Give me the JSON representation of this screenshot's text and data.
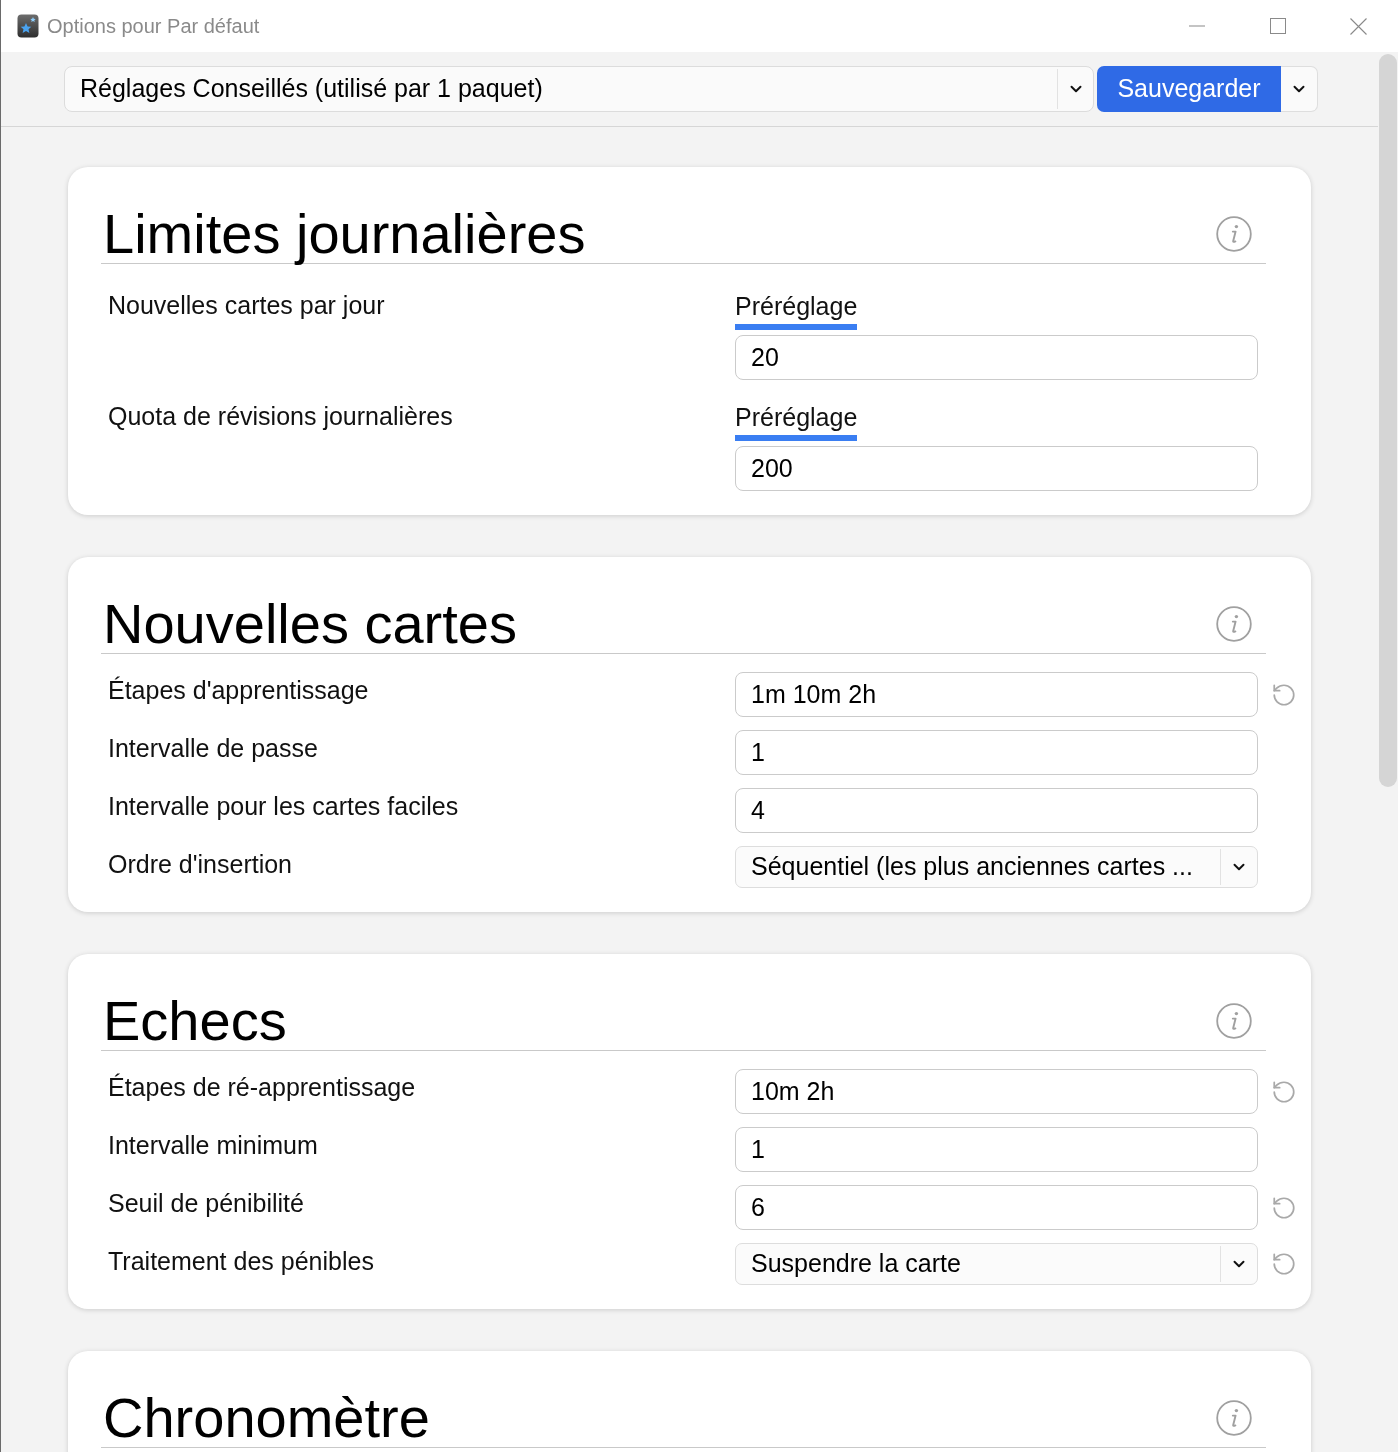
{
  "window": {
    "title": "Options pour Par défaut"
  },
  "toolbar": {
    "preset_select": {
      "value": "Réglages Conseillés (utilisé par 1 paquet)"
    },
    "save_button": {
      "label": "Sauvegarder"
    }
  },
  "sections": [
    {
      "title": "Limites journalières",
      "rows": [
        {
          "kind": "preset",
          "label": "Nouvelles cartes par jour",
          "tabs": [
            {
              "label": "Préréglage",
              "selected": true
            }
          ],
          "value": "20",
          "modified": false
        },
        {
          "kind": "preset",
          "label": "Quota de révisions journalières",
          "tabs": [
            {
              "label": "Préréglage",
              "selected": true
            }
          ],
          "value": "200",
          "modified": false
        }
      ]
    },
    {
      "title": "Nouvelles cartes",
      "rows": [
        {
          "kind": "input",
          "label": "Étapes d'apprentissage",
          "value": "1m 10m 2h",
          "modified": true
        },
        {
          "kind": "input",
          "label": "Intervalle de passe",
          "value": "1",
          "modified": false
        },
        {
          "kind": "input",
          "label": "Intervalle pour les cartes faciles",
          "value": "4",
          "modified": false
        },
        {
          "kind": "select",
          "label": "Ordre d'insertion",
          "value": "Séquentiel (les plus anciennes cartes ...",
          "modified": false
        }
      ]
    },
    {
      "title": "Echecs",
      "rows": [
        {
          "kind": "input",
          "label": "Étapes de ré-apprentissage",
          "value": "10m 2h",
          "modified": true
        },
        {
          "kind": "input",
          "label": "Intervalle minimum",
          "value": "1",
          "modified": false
        },
        {
          "kind": "input",
          "label": "Seuil de pénibilité",
          "value": "6",
          "modified": true
        },
        {
          "kind": "select",
          "label": "Traitement des pénibles",
          "value": "Suspendre la carte",
          "modified": true
        }
      ]
    },
    {
      "title": "Chronomètre"
    }
  ]
}
